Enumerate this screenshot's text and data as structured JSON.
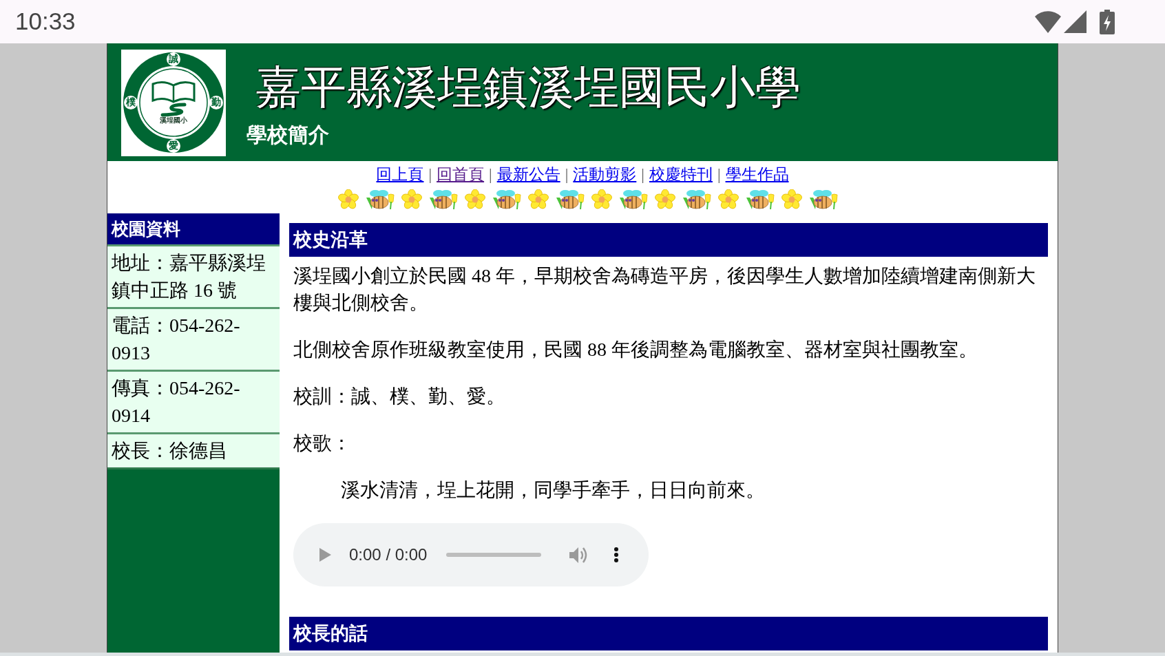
{
  "status_bar": {
    "time": "10:33"
  },
  "header": {
    "logo": {
      "ring_characters": [
        "誠",
        "樸",
        "勤",
        "愛"
      ],
      "caption": "溪埕國小"
    },
    "title": "嘉平縣溪埕鎮溪埕國民小學",
    "subtitle": "學校簡介"
  },
  "nav": {
    "items": [
      {
        "kind": "link",
        "label": "回上頁",
        "visited": false
      },
      {
        "kind": "separator",
        "label": "|"
      },
      {
        "kind": "link",
        "label": "回首頁",
        "visited": true
      },
      {
        "kind": "separator",
        "label": "|"
      },
      {
        "kind": "link",
        "label": "最新公告",
        "visited": false
      },
      {
        "kind": "separator",
        "label": "|"
      },
      {
        "kind": "link",
        "label": "活動剪影",
        "visited": false
      },
      {
        "kind": "separator",
        "label": "|"
      },
      {
        "kind": "link",
        "label": "校慶特刊",
        "visited": false
      },
      {
        "kind": "separator",
        "label": "|"
      },
      {
        "kind": "link",
        "label": "學生作品",
        "visited": false
      }
    ]
  },
  "sidebar": {
    "title": "校園資料",
    "items": [
      "地址：嘉平縣溪埕鎮中正路 16 號",
      "電話：054-262-0913",
      "傳真：054-262-0914",
      "校長：徐德昌"
    ]
  },
  "sections": [
    {
      "title": "校史沿革",
      "blocks": [
        {
          "kind": "paragraph",
          "text": "溪埕國小創立於民國 48 年，早期校舍為磚造平房，後因學生人數增加陸續增建南側新大樓與北側校舍。"
        },
        {
          "kind": "paragraph",
          "text": "北側校舍原作班級教室使用，民國 88 年後調整為電腦教室、器材室與社團教室。"
        },
        {
          "kind": "paragraph",
          "text": "校訓：誠、樸、勤、愛。"
        },
        {
          "kind": "paragraph",
          "text": "校歌："
        },
        {
          "kind": "verse",
          "text": "溪水清清，埕上花開，同學手牽手，日日向前來。"
        },
        {
          "kind": "audio",
          "time": "0:00 / 0:00"
        }
      ]
    },
    {
      "title": "校長的話"
    }
  ]
}
